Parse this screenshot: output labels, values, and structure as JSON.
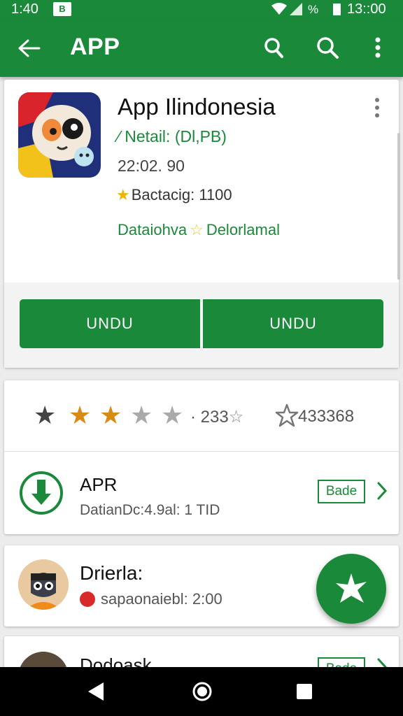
{
  "status_bar": {
    "time_left": "1:40",
    "app_badge": "B",
    "battery_text": "%",
    "time_right": "13::00"
  },
  "app_bar": {
    "title": "APP"
  },
  "app_card": {
    "name": "App Ilindonesia",
    "developer": "Netail: (Dl,PB)",
    "date": "22:02. 90",
    "rating_text": "Bactacig: 1100",
    "tag_left": "Dataiohva",
    "tag_right": "Delorlamal",
    "button_left": "UNDU",
    "button_right": "UNDU"
  },
  "details_card": {
    "rating_count": "· 233",
    "rating_count_2": "433368",
    "stars_filled": 2,
    "download_title": "APR",
    "download_sub": "DatianDc:4.9al: 1 TID",
    "download_badge": "Bade"
  },
  "user_card_1": {
    "name": "Drierla:",
    "sub": "sapaonaiebl: 2:00"
  },
  "user_card_2": {
    "name": "Dodoask",
    "badge": "Bade"
  },
  "colors": {
    "brand_green": "#1a8a3a",
    "star_gold": "#f0b400",
    "star_orange": "#d98a14"
  }
}
